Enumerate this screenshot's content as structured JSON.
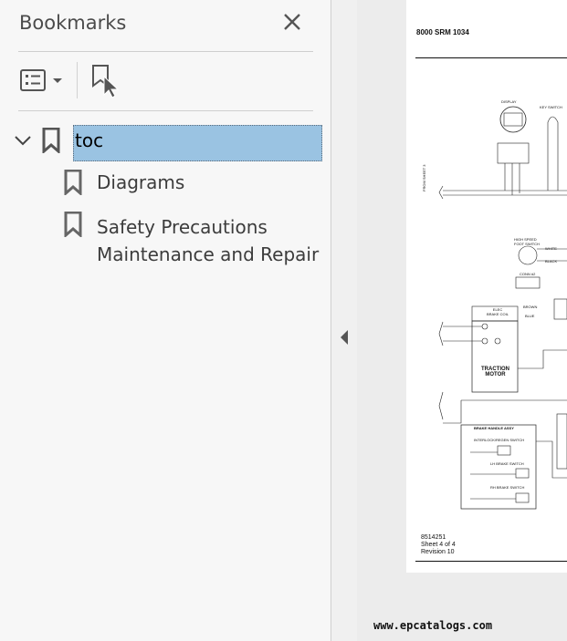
{
  "panel": {
    "title": "Bookmarks"
  },
  "bookmarks": {
    "root": {
      "label": "toc",
      "expanded": true,
      "selected": true
    },
    "children": [
      {
        "label": "Diagrams"
      },
      {
        "label_lines": [
          "Safety Precautions",
          "Maintenance and Repair"
        ]
      }
    ]
  },
  "document": {
    "header": "8000 SRM 1034",
    "labels": {
      "display": "DISPLAY",
      "key_switch": "KEY SWITCH",
      "conn_hi": "HIGH SPEED\nFOOT SWITCH",
      "white": "WHITE",
      "black": "BLACK",
      "conn": "CONN #2",
      "brown": "BROWN",
      "blue": "BLUE",
      "elec_brake_coil": "ELEC\nBRAKE COIL",
      "traction_motor": "TRACTION\nMOTOR",
      "brake_handle_assy": "BRAKE HANDLE ASSY",
      "interlock": "INTERLOCK/REGEN SWITCH",
      "lh_brake": "LH BRAKE SWITCH",
      "rh_brake": "RH BRAKE SWITCH",
      "from_sheet": "FROM SHEET 3"
    },
    "footer_lines": [
      "8514251",
      "Sheet 4 of 4",
      "Revision 10"
    ]
  },
  "watermark": "www.epcatalogs.com",
  "colors": {
    "selection": "#9ac3e2",
    "panel_bg": "#f7f7f7"
  }
}
